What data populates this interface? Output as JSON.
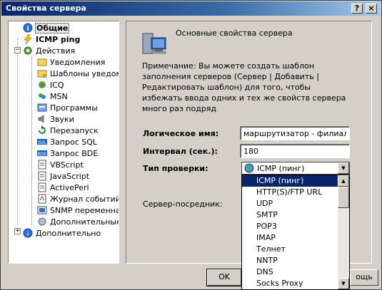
{
  "window": {
    "title": "Свойства сервера",
    "help_label": "?",
    "close_label": "×"
  },
  "tree": {
    "items": [
      {
        "label": "Общие",
        "icon": "info-icon",
        "bold": true,
        "selected": true
      },
      {
        "label": "ICMP ping",
        "icon": "lightning-icon",
        "bold": true
      },
      {
        "label": "Действия",
        "icon": "gear-icon"
      },
      {
        "label": "Уведомления",
        "icon": "folder-icon"
      },
      {
        "label": "Шаблоны уведомл",
        "icon": "folder-lock-icon"
      },
      {
        "label": "ICQ",
        "icon": "icq-flower-icon"
      },
      {
        "label": "MSN",
        "icon": "msn-icon"
      },
      {
        "label": "Программы",
        "icon": "programs-icon"
      },
      {
        "label": "Звуки",
        "icon": "speaker-icon"
      },
      {
        "label": "Перезапуск",
        "icon": "restart-icon"
      },
      {
        "label": "Запрос SQL",
        "icon": "sql-icon"
      },
      {
        "label": "Запрос BDE",
        "icon": "bde-icon"
      },
      {
        "label": "VBScript",
        "icon": "script-icon"
      },
      {
        "label": "JavaScript",
        "icon": "script-icon"
      },
      {
        "label": "ActivePerl",
        "icon": "script-icon"
      },
      {
        "label": "Журнал событий",
        "icon": "journal-icon"
      },
      {
        "label": "SNMP переменна",
        "icon": "snmp-icon"
      },
      {
        "label": "Дополнительные",
        "icon": "extra-icon"
      },
      {
        "label": "Дополнительно",
        "icon": "info-icon"
      }
    ]
  },
  "panel": {
    "title": "Основные свойства сервера",
    "note": "Примечание: Вы можете создать шаблон заполнения серверов (Сервер | Добавить | Редактировать шаблон) для того, чтобы избежать ввода одних и тех же свойств сервера много раз подряд",
    "logical_name_label": "Логическое имя:",
    "logical_name_value": "маршрутизатор - филиал",
    "interval_label": "Интервал (сек.):",
    "interval_value": "180",
    "check_type_label": "Тип проверки:",
    "check_type_value": "ICMP (пинг)",
    "proxy_label": "Сервер-посредник:"
  },
  "dropdown": {
    "options": [
      "ICMP (пинг)",
      "HTTP(S)/FTP URL",
      "UDP",
      "SMTP",
      "POP3",
      "IMAP",
      "Телнет",
      "NNTP",
      "DNS",
      "Socks Proxy"
    ],
    "selected_index": 0
  },
  "buttons": {
    "ok_label": "OK",
    "help_label": "ощь"
  }
}
